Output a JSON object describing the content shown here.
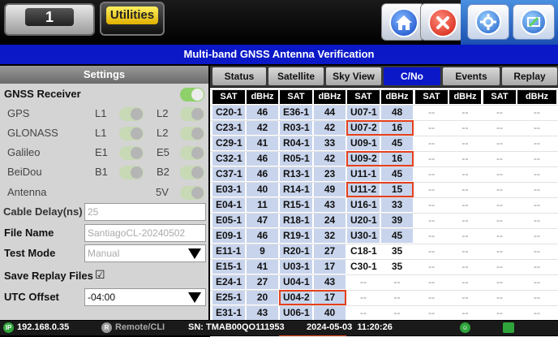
{
  "topbar": {
    "tab_number": "1",
    "tab_utilities": "Utilities",
    "buttons": [
      "home-icon",
      "close-icon",
      "settings-icon",
      "tools-icon"
    ]
  },
  "title": "Multi-band GNSS Antenna Verification",
  "settings": {
    "header": "Settings",
    "gnss_receiver": {
      "label": "GNSS Receiver",
      "on": true
    },
    "systems": [
      {
        "label": "GPS",
        "b1": "L1",
        "b2": "L2"
      },
      {
        "label": "GLONASS",
        "b1": "L1",
        "b2": "L2"
      },
      {
        "label": "Galileo",
        "b1": "E1",
        "b2": "E5"
      },
      {
        "label": "BeiDou",
        "b1": "B1",
        "b2": "B2"
      }
    ],
    "antenna": {
      "label": "Antenna",
      "value": "5V"
    },
    "cable_delay": {
      "label": "Cable Delay(ns)",
      "placeholder": "25"
    },
    "file_name": {
      "label": "File Name",
      "placeholder": "SantiagoCL-20240502"
    },
    "test_mode": {
      "label": "Test Mode",
      "value": "Manual"
    },
    "save_replay": {
      "label": "Save Replay Files",
      "checkbox": "☑"
    },
    "utc_offset": {
      "label": "UTC Offset",
      "value": "-04:00"
    }
  },
  "tabs": [
    {
      "label": "Status",
      "active": false
    },
    {
      "label": "Satellite",
      "active": false
    },
    {
      "label": "Sky View",
      "active": false
    },
    {
      "label": "C/No",
      "active": true
    },
    {
      "label": "Events",
      "active": false
    },
    {
      "label": "Replay",
      "active": false
    }
  ],
  "table": {
    "headers": [
      "SAT",
      "dBHz",
      "SAT",
      "dBHz",
      "SAT",
      "dBHz",
      "SAT",
      "dBHz",
      "SAT",
      "dBHz"
    ],
    "columns": [
      [
        [
          "C20-1",
          "46"
        ],
        [
          "C23-1",
          "42"
        ],
        [
          "C29-1",
          "41"
        ],
        [
          "C32-1",
          "46"
        ],
        [
          "C37-1",
          "46"
        ],
        [
          "E03-1",
          "40"
        ],
        [
          "E04-1",
          "11"
        ],
        [
          "E05-1",
          "47"
        ],
        [
          "E09-1",
          "46"
        ],
        [
          "E11-1",
          "9"
        ],
        [
          "E15-1",
          "41"
        ],
        [
          "E24-1",
          "27"
        ],
        [
          "E25-1",
          "20"
        ],
        [
          "E31-1",
          "43"
        ],
        [
          "E34-1",
          "43"
        ]
      ],
      [
        [
          "E36-1",
          "44"
        ],
        [
          "R03-1",
          "42"
        ],
        [
          "R04-1",
          "33"
        ],
        [
          "R05-1",
          "42"
        ],
        [
          "R13-1",
          "23"
        ],
        [
          "R14-1",
          "49"
        ],
        [
          "R15-1",
          "43"
        ],
        [
          "R18-1",
          "24"
        ],
        [
          "R19-1",
          "32"
        ],
        [
          "R20-1",
          "27"
        ],
        [
          "U03-1",
          "17"
        ],
        [
          "U04-1",
          "43"
        ],
        [
          "U04-2",
          "17"
        ],
        [
          "U06-1",
          "40"
        ],
        [
          "U06-2",
          "14"
        ]
      ],
      [
        [
          "U07-1",
          "48"
        ],
        [
          "U07-2",
          "16"
        ],
        [
          "U09-1",
          "45"
        ],
        [
          "U09-2",
          "16"
        ],
        [
          "U11-1",
          "45"
        ],
        [
          "U11-2",
          "15"
        ],
        [
          "U16-1",
          "33"
        ],
        [
          "U20-1",
          "39"
        ],
        [
          "U30-1",
          "45"
        ],
        [
          "C18-1",
          "35"
        ],
        [
          "C30-1",
          "35"
        ],
        [
          "--",
          "--"
        ],
        [
          "--",
          "--"
        ],
        [
          "--",
          "--"
        ],
        [
          "--",
          "--"
        ]
      ]
    ],
    "white_rows_col3": [
      9,
      10
    ],
    "dash": "--",
    "highlights": [
      {
        "col": 2,
        "row": 1
      },
      {
        "col": 2,
        "row": 3
      },
      {
        "col": 2,
        "row": 5
      },
      {
        "col": 1,
        "row": 12
      },
      {
        "col": 1,
        "row": 14
      }
    ]
  },
  "statusbar": {
    "ip_badge": "IP",
    "ip": "192.168.0.35",
    "remote_badge": "R",
    "remote": "Remote/CLI",
    "sn": "SN: TMAB00QO111953",
    "datetime": "2024-05-03  11:20:26",
    "gnss_badge": "☺"
  }
}
